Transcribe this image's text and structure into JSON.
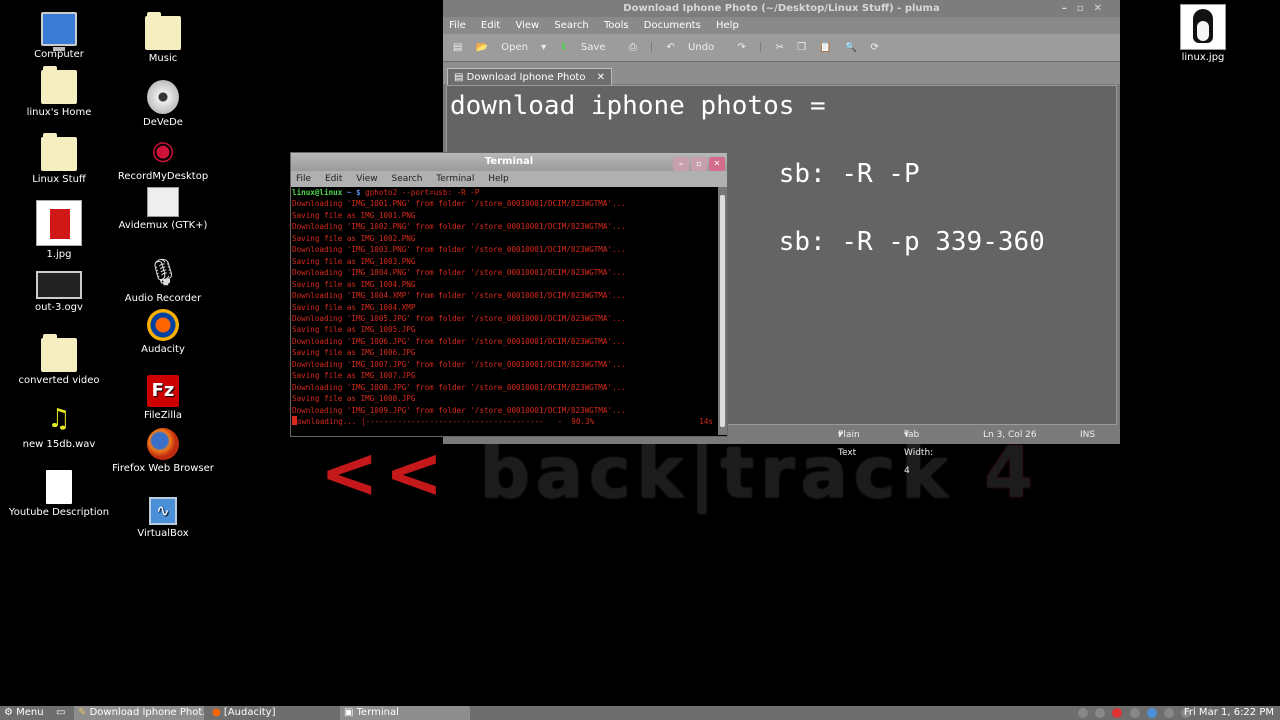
{
  "wallpaper": {
    "arrows": "<<",
    "bt_text": "back|track",
    "version": "4"
  },
  "desktop": {
    "col1": [
      {
        "label": "Computer",
        "icon": "computer-icon"
      },
      {
        "label": "linux's Home",
        "icon": "home-folder-icon"
      },
      {
        "label": "Linux Stuff",
        "icon": "folder-icon"
      },
      {
        "label": "1.jpg",
        "icon": "image-file-icon"
      },
      {
        "label": "out-3.ogv",
        "icon": "video-file-icon"
      },
      {
        "label": "converted video",
        "icon": "folder-icon"
      },
      {
        "label": "new 15db.wav",
        "icon": "audio-file-icon"
      },
      {
        "label": "Youtube Description",
        "icon": "text-file-icon"
      }
    ],
    "col2": [
      {
        "label": "Music",
        "icon": "folder-icon"
      },
      {
        "label": "DeVeDe",
        "icon": "disc-icon"
      },
      {
        "label": "RecordMyDesktop",
        "icon": "recordmydesktop-icon"
      },
      {
        "label": "Avidemux (GTK+)",
        "icon": "avidemux-icon"
      },
      {
        "label": "Audio Recorder",
        "icon": "microphone-icon"
      },
      {
        "label": "Audacity",
        "icon": "audacity-icon"
      },
      {
        "label": "FileZilla",
        "icon": "filezilla-icon"
      },
      {
        "label": "Firefox Web Browser",
        "icon": "firefox-icon"
      },
      {
        "label": "VirtualBox",
        "icon": "virtualbox-icon"
      }
    ],
    "right_icon": {
      "label": "linux.jpg",
      "icon": "tux-image-icon"
    }
  },
  "pluma": {
    "title": "Download Iphone Photo (~/Desktop/Linux Stuff) - pluma",
    "menu": [
      "File",
      "Edit",
      "View",
      "Search",
      "Tools",
      "Documents",
      "Help"
    ],
    "toolbar": {
      "open": "Open",
      "save": "Save",
      "undo": "Undo"
    },
    "tab_label": "Download Iphone Photo",
    "editor_lines": [
      "download iphone photos =",
      "                     sb: -R -P",
      "                     sb: -R -p 339-360"
    ],
    "status": {
      "syntax": "Plain Text",
      "tab_width": "Tab Width: 4",
      "position": "Ln 3, Col 26",
      "mode": "INS"
    }
  },
  "terminal": {
    "title": "Terminal",
    "menu": [
      "File",
      "Edit",
      "View",
      "Search",
      "Terminal",
      "Help"
    ],
    "prompt_user": "linux@linux",
    "prompt_sym": " ~ $ ",
    "command": "gphoto2 --port=usb: -R -P",
    "output": [
      "Downloading 'IMG_1001.PNG' from folder '/store_00010001/DCIM/823WGTMA'...",
      "Saving file as IMG_1001.PNG",
      "Downloading 'IMG_1002.PNG' from folder '/store_00010001/DCIM/823WGTMA'...",
      "Saving file as IMG_1002.PNG",
      "Downloading 'IMG_1003.PNG' from folder '/store_00010001/DCIM/823WGTMA'...",
      "Saving file as IMG_1003.PNG",
      "Downloading 'IMG_1004.PNG' from folder '/store_00010001/DCIM/823WGTMA'...",
      "Saving file as IMG_1004.PNG",
      "Downloading 'IMG_1004.XMP' from folder '/store_00010001/DCIM/823WGTMA'...",
      "Saving file as IMG_1004.XMP",
      "Downloading 'IMG_1005.JPG' from folder '/store_00010001/DCIM/823WGTMA'...",
      "Saving file as IMG_1005.JPG",
      "Downloading 'IMG_1006.JPG' from folder '/store_00010001/DCIM/823WGTMA'...",
      "Saving file as IMG_1006.JPG",
      "Downloading 'IMG_1007.JPG' from folder '/store_00010001/DCIM/823WGTMA'...",
      "Saving file as IMG_1007.JPG",
      "Downloading 'IMG_1008.JPG' from folder '/store_00010001/DCIM/823WGTMA'...",
      "Saving file as IMG_1008.JPG",
      "Downloading 'IMG_1009.JPG' from folder '/store_00010001/DCIM/823WGTMA'..."
    ],
    "progress_line": "ownloading... |---------------------------------------   -  90.3%",
    "progress_eta": "14s",
    "progress_percent": 90.3
  },
  "taskbar": {
    "menu": "Menu",
    "items": [
      "Download Iphone Phot...",
      "[Audacity]",
      "Terminal"
    ],
    "clock": "Fri Mar 1,  6:22 PM"
  },
  "colors": {
    "terminal_text": "#d62a1c",
    "prompt_green": "#4cd84c",
    "wallpaper_red": "#c4181a"
  }
}
